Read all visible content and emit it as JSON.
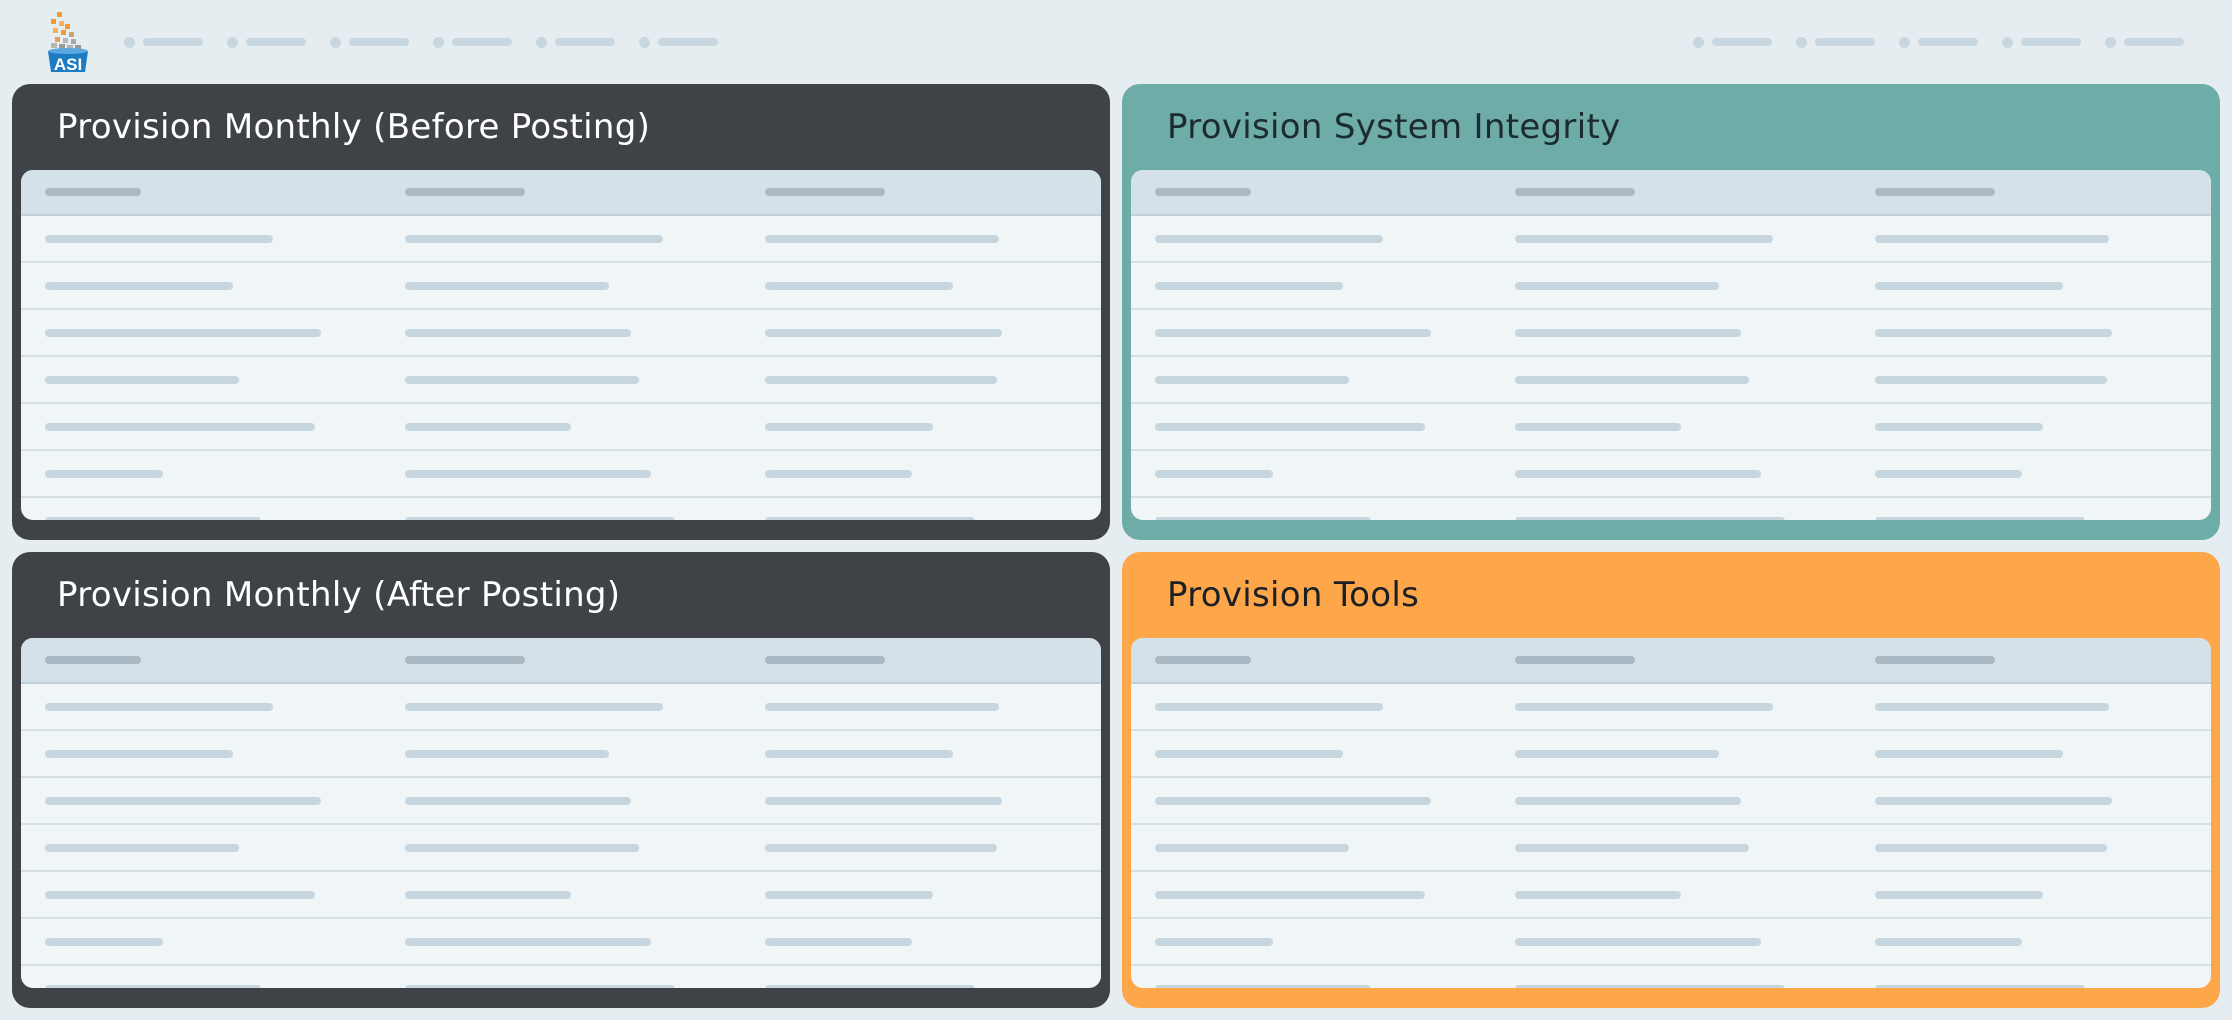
{
  "header": {
    "logo_text": "ASI",
    "nav_left_count": 6,
    "nav_right_count": 5
  },
  "panels": [
    {
      "id": "monthly-before",
      "title": "Provision Monthly (Before Posting)",
      "theme": "dark",
      "color": "#3f4247"
    },
    {
      "id": "system-integrity",
      "title": "Provision System Integrity",
      "theme": "teal",
      "color": "#6eaca7"
    },
    {
      "id": "monthly-after",
      "title": "Provision Monthly (After Posting)",
      "theme": "dark",
      "color": "#3f4247"
    },
    {
      "id": "tools",
      "title": "Provision Tools",
      "theme": "orange",
      "color": "#fda74a"
    }
  ],
  "colors": {
    "background": "#e6edf1",
    "card": "#f0f5f8",
    "table_header": "#d4e1e9",
    "placeholder": "#c7d5de"
  }
}
